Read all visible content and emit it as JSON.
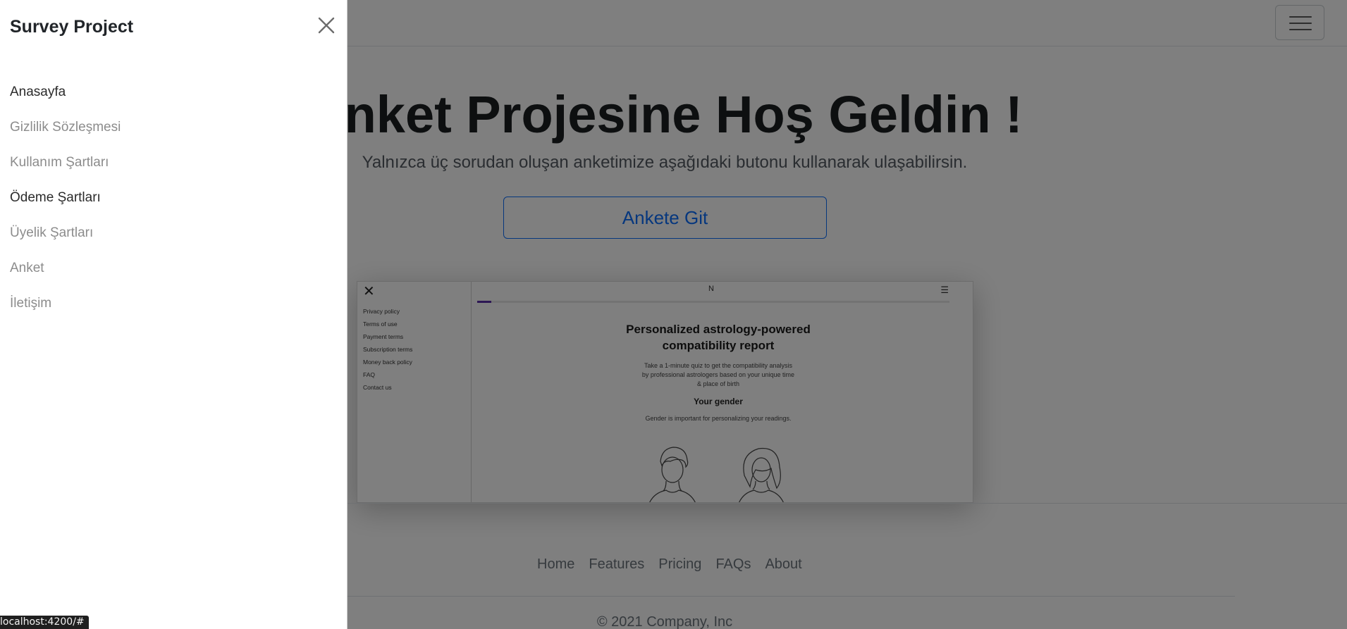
{
  "offcanvas": {
    "title": "Survey Project",
    "items": [
      {
        "label": "Anasayfa"
      },
      {
        "label": "Gizlilik Sözleşmesi"
      },
      {
        "label": "Kullanım Şartları"
      },
      {
        "label": "Ödeme Şartları"
      },
      {
        "label": "Üyelik Şartları"
      },
      {
        "label": "Anket"
      },
      {
        "label": "İletişim"
      }
    ]
  },
  "hero": {
    "title": "Anket Projesine Hoş Geldin !",
    "lead": "Yalnızca üç sorudan oluşan anketimize aşağıdaki butonu kullanarak ulaşabilirsin.",
    "cta_label": "Ankete Git"
  },
  "preview": {
    "menu": [
      "Privacy policy",
      "Terms of use",
      "Payment terms",
      "Subscription terms",
      "Money back policy",
      "FAQ",
      "Contact us"
    ],
    "logo": "N",
    "heading_line1": "Personalized astrology-powered",
    "heading_line2": "compatibility report",
    "sub_line1": "Take a 1-minute quiz to get the compatibility analysis",
    "sub_line2": "by professional astrologers based on your unique time",
    "sub_line3": "& place of birth",
    "gender_title": "Your gender",
    "gender_sub": "Gender is important for personalizing your readings."
  },
  "footer": {
    "nav": [
      {
        "label": "Home"
      },
      {
        "label": "Features"
      },
      {
        "label": "Pricing"
      },
      {
        "label": "FAQs"
      },
      {
        "label": "About"
      }
    ],
    "copyright": "© 2021 Company, Inc"
  },
  "statusbar": {
    "url": "localhost:4200/#"
  },
  "colors": {
    "primary": "#0d6efd",
    "backdrop": "rgba(0,0,0,0.5)",
    "progress_accent": "#5b2fa8"
  }
}
